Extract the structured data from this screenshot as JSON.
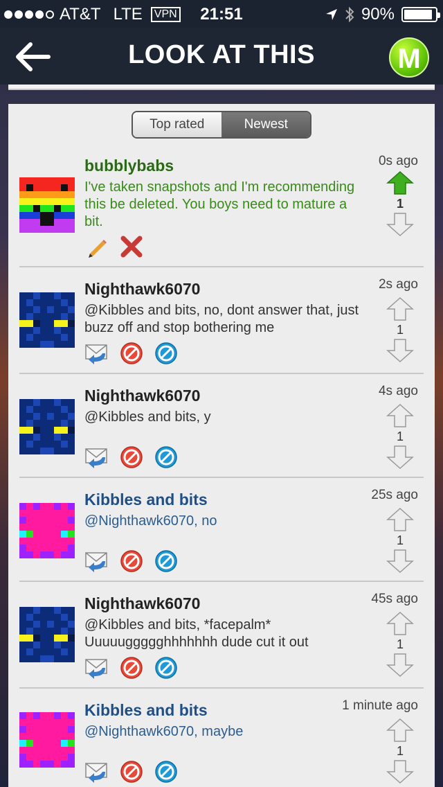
{
  "status_bar": {
    "carrier": "AT&T",
    "network": "LTE",
    "vpn": "VPN",
    "time": "21:51",
    "battery": "90%",
    "battery_level": 0.9
  },
  "nav": {
    "title": "LOOK AT THIS",
    "logo_letter": "M"
  },
  "tabs": [
    {
      "label": "Top rated",
      "selected": false
    },
    {
      "label": "Newest",
      "selected": true
    }
  ],
  "comments": [
    {
      "user": "bubblybabs",
      "time": "0s ago",
      "text": "I've taken snapshots and I'm recommending this be deleted.  You boys need to mature a bit.",
      "votes": "1",
      "upvoted": true,
      "own": true
    },
    {
      "user": "Nighthawk6070",
      "time": "2s ago",
      "text": "@Kibbles and bits, no, dont answer that, just buzz off and stop bothering me",
      "votes": "1"
    },
    {
      "user": "Nighthawk6070",
      "time": "4s ago",
      "text": "@Kibbles and bits, y",
      "votes": "1"
    },
    {
      "user": "Kibbles and bits",
      "time": "25s ago",
      "text": "@Nighthawk6070, no",
      "votes": "1"
    },
    {
      "user": "Nighthawk6070",
      "time": "45s ago",
      "text": "@Kibbles and bits, *facepalm* Uuuuuggggghhhhhhh dude cut it out",
      "votes": "1"
    },
    {
      "user": "Kibbles and bits",
      "time": "1 minute ago",
      "text": "@Nighthawk6070, maybe",
      "votes": "1"
    }
  ],
  "icons": {
    "back": "back-arrow-icon",
    "edit": "pencil-icon",
    "delete": "red-x-icon",
    "reply": "reply-mail-icon",
    "report": "red-block-icon",
    "ignore": "blue-block-icon",
    "upvote": "up-arrow-icon",
    "downvote": "down-arrow-icon"
  },
  "colors": {
    "accent_green": "#5cbf06",
    "username_green": "#2a6a16",
    "username_blue": "#1f4f86",
    "panel_bg": "#ededed"
  }
}
